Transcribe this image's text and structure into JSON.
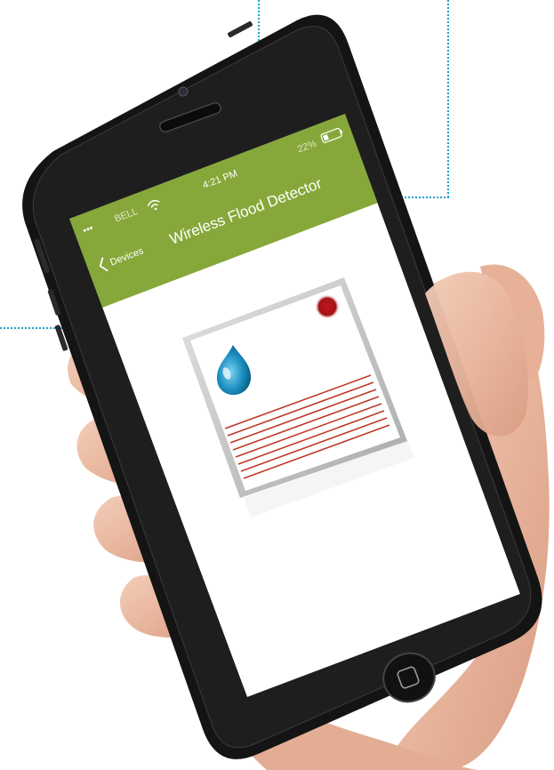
{
  "status_bar": {
    "carrier": "BELL",
    "time": "4:21 PM",
    "battery": "22%"
  },
  "nav": {
    "back_label": "Devices",
    "title": "Wireless Flood Detector"
  },
  "icons": {
    "back": "chevron-left-icon",
    "wifi": "wifi-icon",
    "battery": "battery-icon",
    "water_drop": "water-drop-icon",
    "status_led": "status-led-icon",
    "home": "home-button-icon"
  },
  "colors": {
    "nav_green": "#86a83a",
    "phone_body": "#141414",
    "screen_bg": "#ffffff",
    "guide_line": "#1aa3c8",
    "sensor_frame": "#bfbfbf",
    "led_red": "#b5161b",
    "stripe_red": "#c0392b",
    "drop_blue": "#1b8fc0"
  }
}
